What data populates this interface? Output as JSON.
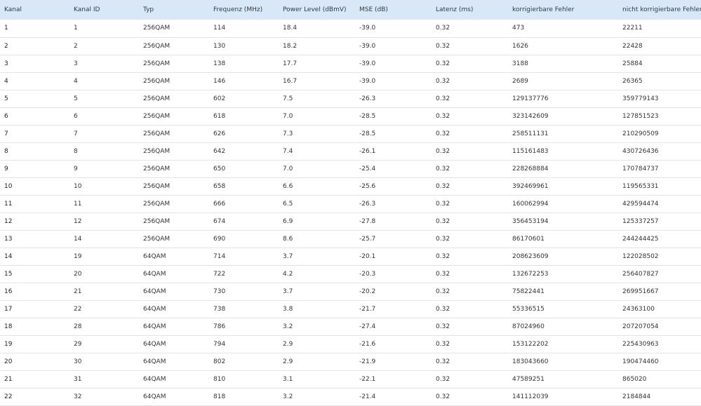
{
  "table": {
    "headers": [
      "Kanal",
      "Kanal ID",
      "Typ",
      "Frequenz (MHz)",
      "Power Level (dBmV)",
      "MSE (dB)",
      "Latenz (ms)",
      "korrigierbare Fehler",
      "nicht korrigierbare Fehler"
    ],
    "rows": [
      [
        "1",
        "1",
        "256QAM",
        "114",
        "18.4",
        "-39.0",
        "0.32",
        "473",
        "22211"
      ],
      [
        "2",
        "2",
        "256QAM",
        "130",
        "18.2",
        "-39.0",
        "0.32",
        "1626",
        "22428"
      ],
      [
        "3",
        "3",
        "256QAM",
        "138",
        "17.7",
        "-39.0",
        "0.32",
        "3188",
        "25884"
      ],
      [
        "4",
        "4",
        "256QAM",
        "146",
        "16.7",
        "-39.0",
        "0.32",
        "2689",
        "26365"
      ],
      [
        "5",
        "5",
        "256QAM",
        "602",
        "7.5",
        "-26.3",
        "0.32",
        "129137776",
        "359779143"
      ],
      [
        "6",
        "6",
        "256QAM",
        "618",
        "7.0",
        "-28.5",
        "0.32",
        "323142609",
        "127851523"
      ],
      [
        "7",
        "7",
        "256QAM",
        "626",
        "7.3",
        "-28.5",
        "0.32",
        "258511131",
        "210290509"
      ],
      [
        "8",
        "8",
        "256QAM",
        "642",
        "7.4",
        "-26.1",
        "0.32",
        "115161483",
        "430726436"
      ],
      [
        "9",
        "9",
        "256QAM",
        "650",
        "7.0",
        "-25.4",
        "0.32",
        "228268884",
        "170784737"
      ],
      [
        "10",
        "10",
        "256QAM",
        "658",
        "6.6",
        "-25.6",
        "0.32",
        "392469961",
        "119565331"
      ],
      [
        "11",
        "11",
        "256QAM",
        "666",
        "6.5",
        "-26.3",
        "0.32",
        "160062994",
        "429594474"
      ],
      [
        "12",
        "12",
        "256QAM",
        "674",
        "6.9",
        "-27.8",
        "0.32",
        "356453194",
        "125337257"
      ],
      [
        "13",
        "14",
        "256QAM",
        "690",
        "8.6",
        "-25.7",
        "0.32",
        "86170601",
        "244244425"
      ],
      [
        "14",
        "19",
        "64QAM",
        "714",
        "3.7",
        "-20.1",
        "0.32",
        "208623609",
        "122028502"
      ],
      [
        "15",
        "20",
        "64QAM",
        "722",
        "4.2",
        "-20.3",
        "0.32",
        "132672253",
        "256407827"
      ],
      [
        "16",
        "21",
        "64QAM",
        "730",
        "3.7",
        "-20.2",
        "0.32",
        "75822441",
        "269951667"
      ],
      [
        "17",
        "22",
        "64QAM",
        "738",
        "3.8",
        "-21.7",
        "0.32",
        "55336515",
        "24363100"
      ],
      [
        "18",
        "28",
        "64QAM",
        "786",
        "3.2",
        "-27.4",
        "0.32",
        "87024960",
        "207207054"
      ],
      [
        "19",
        "29",
        "64QAM",
        "794",
        "2.9",
        "-21.6",
        "0.32",
        "153122202",
        "225430963"
      ],
      [
        "20",
        "30",
        "64QAM",
        "802",
        "2.9",
        "-21.9",
        "0.32",
        "183043660",
        "190474460"
      ],
      [
        "21",
        "31",
        "64QAM",
        "810",
        "3.1",
        "-22.1",
        "0.32",
        "47589251",
        "865020"
      ],
      [
        "22",
        "32",
        "64QAM",
        "818",
        "3.2",
        "-21.4",
        "0.32",
        "141112039",
        "2184844"
      ]
    ]
  },
  "colors": {
    "header_background": "#d9e8f6",
    "row_divider": "#e3e3e3",
    "text": "#333333"
  }
}
